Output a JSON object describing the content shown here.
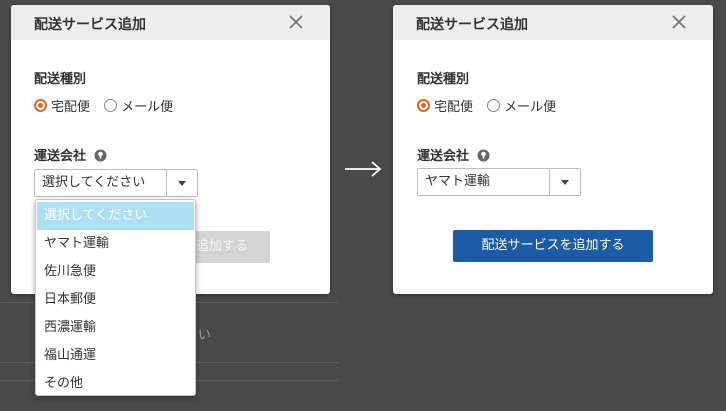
{
  "left_dialog": {
    "title": "配送サービス追加",
    "section_type_label": "配送種別",
    "radio_options": [
      {
        "label": "宅配便",
        "checked": true
      },
      {
        "label": "メール便",
        "checked": false
      }
    ],
    "carrier_label": "運送会社",
    "carrier_select_value": "選択してください",
    "submit_label": "追加する"
  },
  "dropdown": {
    "options": [
      "選択してください",
      "ヤマト運輸",
      "佐川急便",
      "日本郵便",
      "西濃運輸",
      "福山通運",
      "その他"
    ],
    "highlighted": "選択してください"
  },
  "right_dialog": {
    "title": "配送サービス追加",
    "section_type_label": "配送種別",
    "radio_options": [
      {
        "label": "宅配便",
        "checked": true
      },
      {
        "label": "メール便",
        "checked": false
      }
    ],
    "carrier_label": "運送会社",
    "carrier_select_value": "ヤマト運輸",
    "submit_label": "配送サービスを追加する"
  },
  "background": {
    "partial_text": "い"
  },
  "colors": {
    "accent_radio": "#e2641e",
    "primary_button": "#1c5ba6",
    "highlight_option": "#aee0f5",
    "overlay_bg": "#4a4a4a"
  }
}
